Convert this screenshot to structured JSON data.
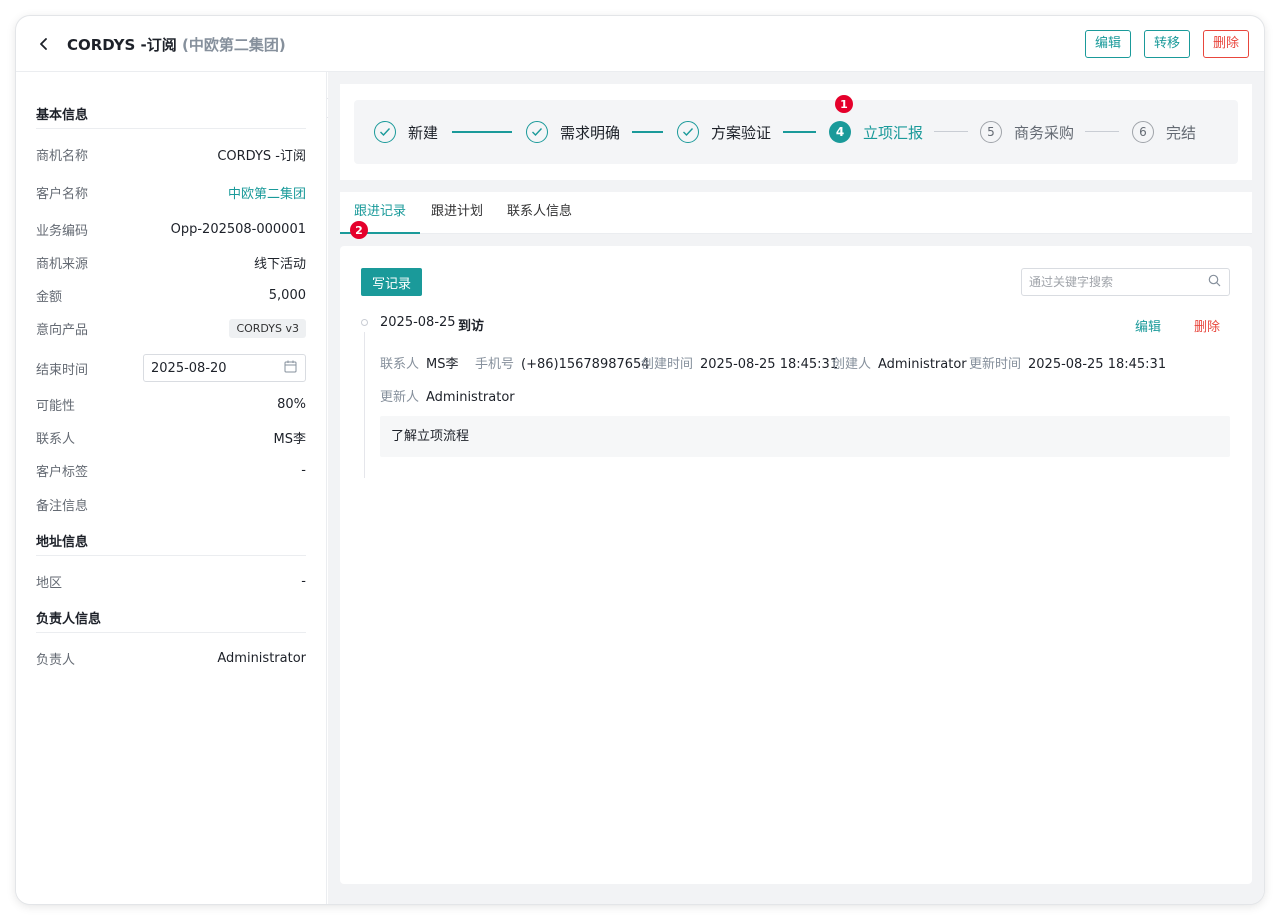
{
  "header": {
    "title": "CORDYS -订阅",
    "subtitle": "(中欧第二集团)",
    "edit_label": "编辑",
    "transfer_label": "转移",
    "delete_label": "删除"
  },
  "sidebar": {
    "basic_title": "基本信息",
    "basic_rows": [
      {
        "key": "商机名称",
        "value": "CORDYS -订阅"
      },
      {
        "key": "客户名称",
        "value": "中欧第二集团"
      },
      {
        "key": "业务编码",
        "value": "Opp-202508-000001"
      },
      {
        "key": "商机来源",
        "value": "线下活动"
      },
      {
        "key": "金额",
        "value": "5,000"
      },
      {
        "key": "意向产品",
        "value": "CORDYS v3"
      },
      {
        "key": "结束时间",
        "value": "2025-08-20"
      },
      {
        "key": "可能性",
        "value": "80%"
      },
      {
        "key": "联系人",
        "value": "MS李"
      },
      {
        "key": "客户标签",
        "value": "-"
      },
      {
        "key": "备注信息",
        "value": ""
      }
    ],
    "address_title": "地址信息",
    "address_rows": [
      {
        "key": "地区",
        "value": "-"
      }
    ],
    "owner_title": "负责人信息",
    "owner_rows": [
      {
        "key": "负责人",
        "value": "Administrator"
      }
    ]
  },
  "steps": [
    {
      "num": "1",
      "label": "新建",
      "state": "done"
    },
    {
      "num": "2",
      "label": "需求明确",
      "state": "done"
    },
    {
      "num": "3",
      "label": "方案验证",
      "state": "done"
    },
    {
      "num": "4",
      "label": "立项汇报",
      "state": "current"
    },
    {
      "num": "5",
      "label": "商务采购",
      "state": "todo"
    },
    {
      "num": "6",
      "label": "完结",
      "state": "todo"
    }
  ],
  "badges": {
    "steps": "1",
    "tabs": "2"
  },
  "tabs": [
    {
      "label": "跟进记录",
      "active": true
    },
    {
      "label": "跟进计划",
      "active": false
    },
    {
      "label": "联系人信息",
      "active": false
    }
  ],
  "records": {
    "write_label": "写记录",
    "search_placeholder": "通过关键字搜索",
    "items": [
      {
        "date": "2025-08-25",
        "type": "到访",
        "edit_label": "编辑",
        "delete_label": "删除",
        "contact_key": "联系人",
        "contact": "MS李",
        "phone_key": "手机号",
        "phone": "(+86)15678987654",
        "created_key": "创建时间",
        "created": "2025-08-25 18:45:31",
        "creator_key": "创建人",
        "creator": "Administrator",
        "updated_key": "更新时间",
        "updated": "2025-08-25 18:45:31",
        "updater_key": "更新人",
        "updater": "Administrator",
        "content": "了解立项流程"
      }
    ]
  },
  "colors": {
    "accent": "#1a9a9a",
    "danger": "#e8463c",
    "badge": "#e5002b"
  }
}
